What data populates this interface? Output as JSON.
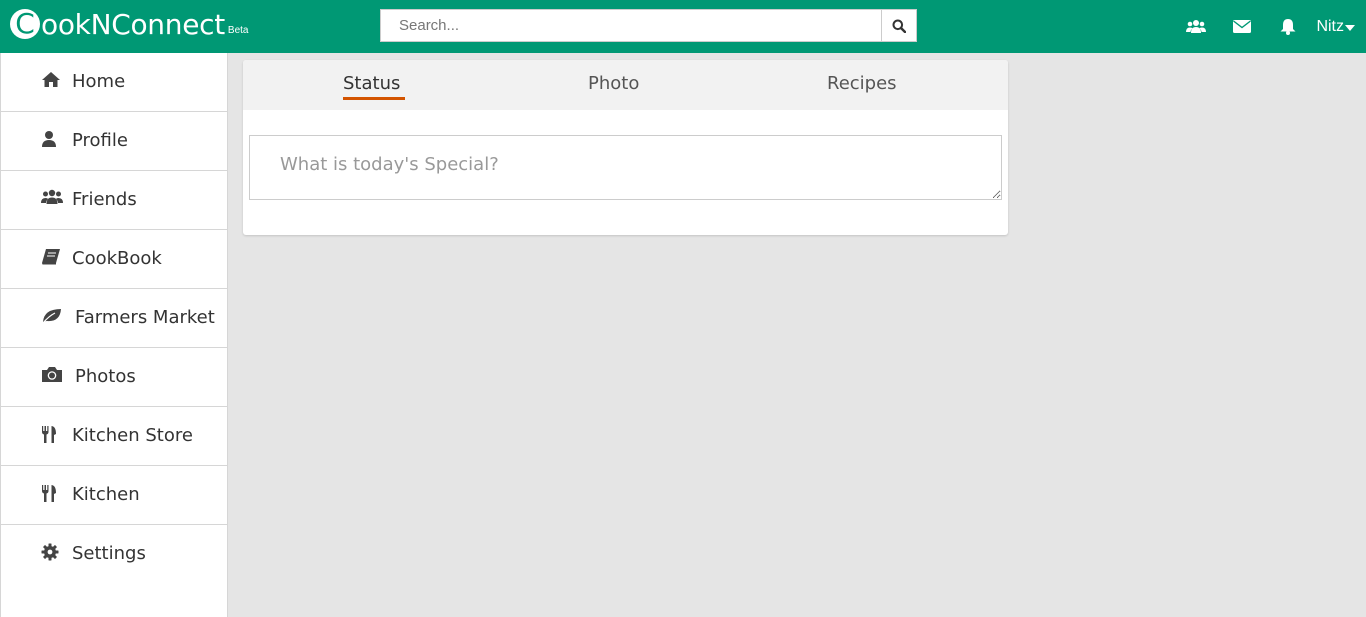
{
  "app": {
    "logo_letter": "C",
    "logo_text": "ookNConnect",
    "logo_badge": "Beta",
    "brand_color": "#009874"
  },
  "search": {
    "placeholder": "Search...",
    "button_icon": "search-icon"
  },
  "header": {
    "icons": [
      "friends-icon",
      "envelope-icon",
      "bell-icon"
    ],
    "user_name": "Nitz"
  },
  "sidebar": {
    "items": [
      {
        "label": "Home",
        "icon": "home-icon"
      },
      {
        "label": "Profile",
        "icon": "user-icon"
      },
      {
        "label": "Friends",
        "icon": "users-icon"
      },
      {
        "label": "CookBook",
        "icon": "book-icon"
      },
      {
        "label": "Farmers Market",
        "icon": "leaf-icon"
      },
      {
        "label": "Photos",
        "icon": "camera-icon"
      },
      {
        "label": "Kitchen Store",
        "icon": "cutlery-icon"
      },
      {
        "label": "Kitchen",
        "icon": "cutlery-icon"
      },
      {
        "label": "Settings",
        "icon": "gear-icon"
      }
    ]
  },
  "composer": {
    "tabs": [
      {
        "label": "Status",
        "active": true
      },
      {
        "label": "Photo",
        "active": false
      },
      {
        "label": "Recipes",
        "active": false
      }
    ],
    "placeholder": "What is today's Special?",
    "accent_color": "#d35400"
  }
}
